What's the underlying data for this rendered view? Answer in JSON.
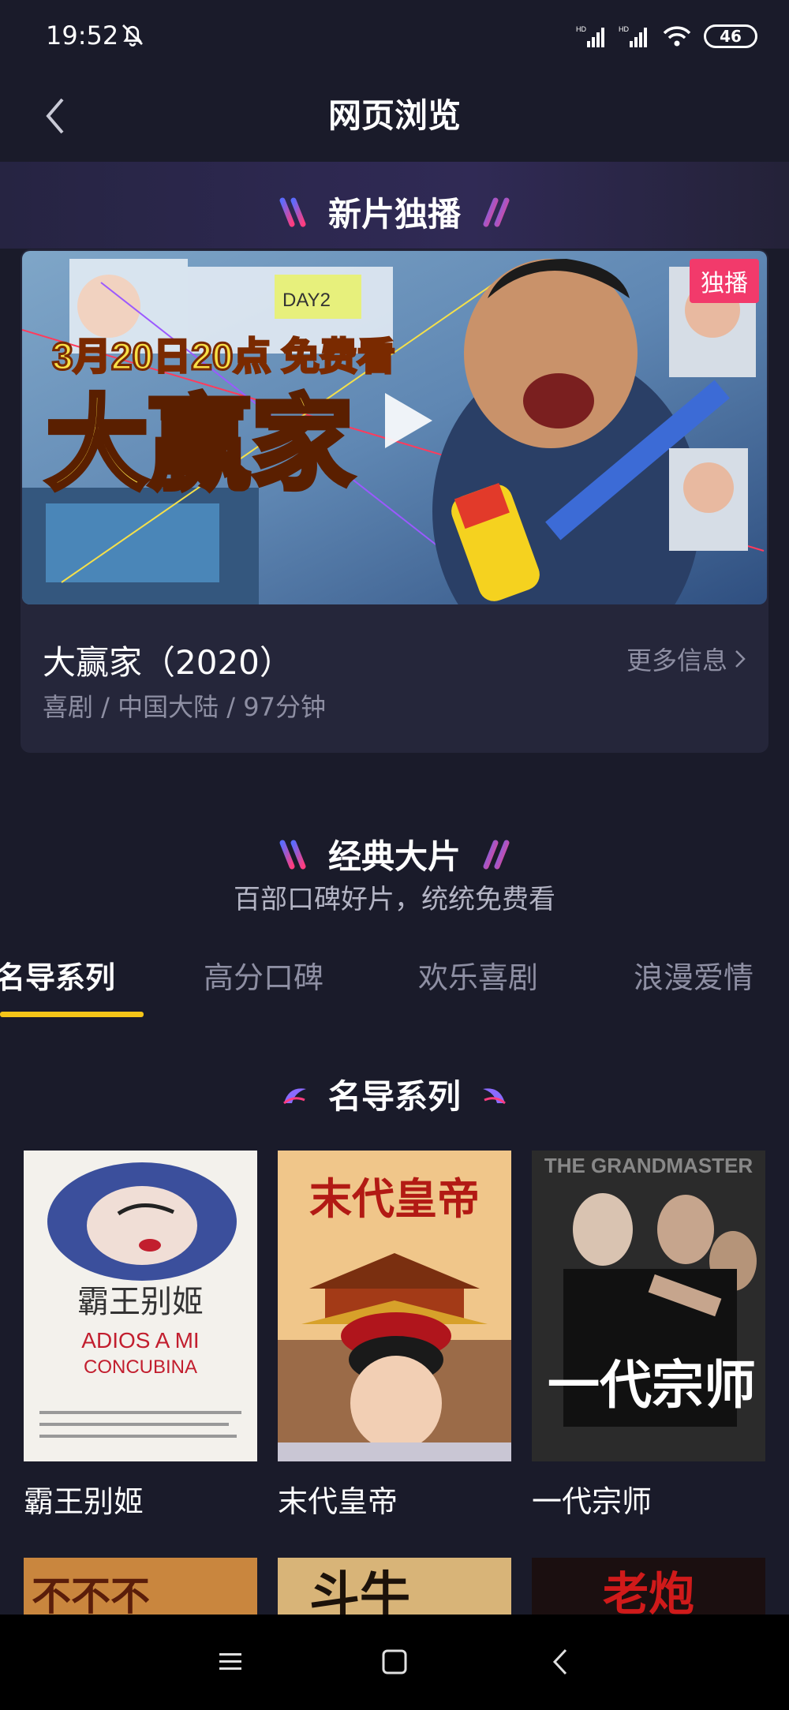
{
  "status": {
    "time": "19:52",
    "battery": "46"
  },
  "header": {
    "title": "网页浏览"
  },
  "new_releases": {
    "section_title": "新片独播",
    "badge": "独播",
    "poster_text_top": "3月20日20点 免费看",
    "poster_text_main": "大赢家",
    "poster_note": "DAY2",
    "movie_title": "大赢家（2020）",
    "meta": "喜剧 / 中国大陆  / 97分钟",
    "more_info": "更多信息"
  },
  "classics": {
    "section_title": "经典大片",
    "subtitle": "百部口碑好片，统统免费看"
  },
  "tabs": [
    {
      "label": "名导系列",
      "active": true
    },
    {
      "label": "高分口碑",
      "active": false
    },
    {
      "label": "欢乐喜剧",
      "active": false
    },
    {
      "label": "浪漫爱情",
      "active": false
    }
  ],
  "director_series": {
    "section_title": "名导系列",
    "movies": [
      {
        "name": "霸王别姬",
        "poster_cn": "霸王别姬",
        "poster_en1": "ADIOS A MI",
        "poster_en2": "CONCUBINA"
      },
      {
        "name": "末代皇帝",
        "poster_cn": "末代皇帝"
      },
      {
        "name": "一代宗师",
        "poster_cn": "一代宗师",
        "poster_en": "THE GRANDMASTER"
      }
    ],
    "next_row": [
      {
        "poster_cn": "不不不"
      },
      {
        "poster_cn": "斗牛"
      },
      {
        "poster_cn": "老炮"
      }
    ]
  },
  "colors": {
    "background": "#1a1b2a",
    "card": "#25263a",
    "accent": "#f5c518",
    "badge": "#f23a6b",
    "muted": "#8e8fa3"
  }
}
